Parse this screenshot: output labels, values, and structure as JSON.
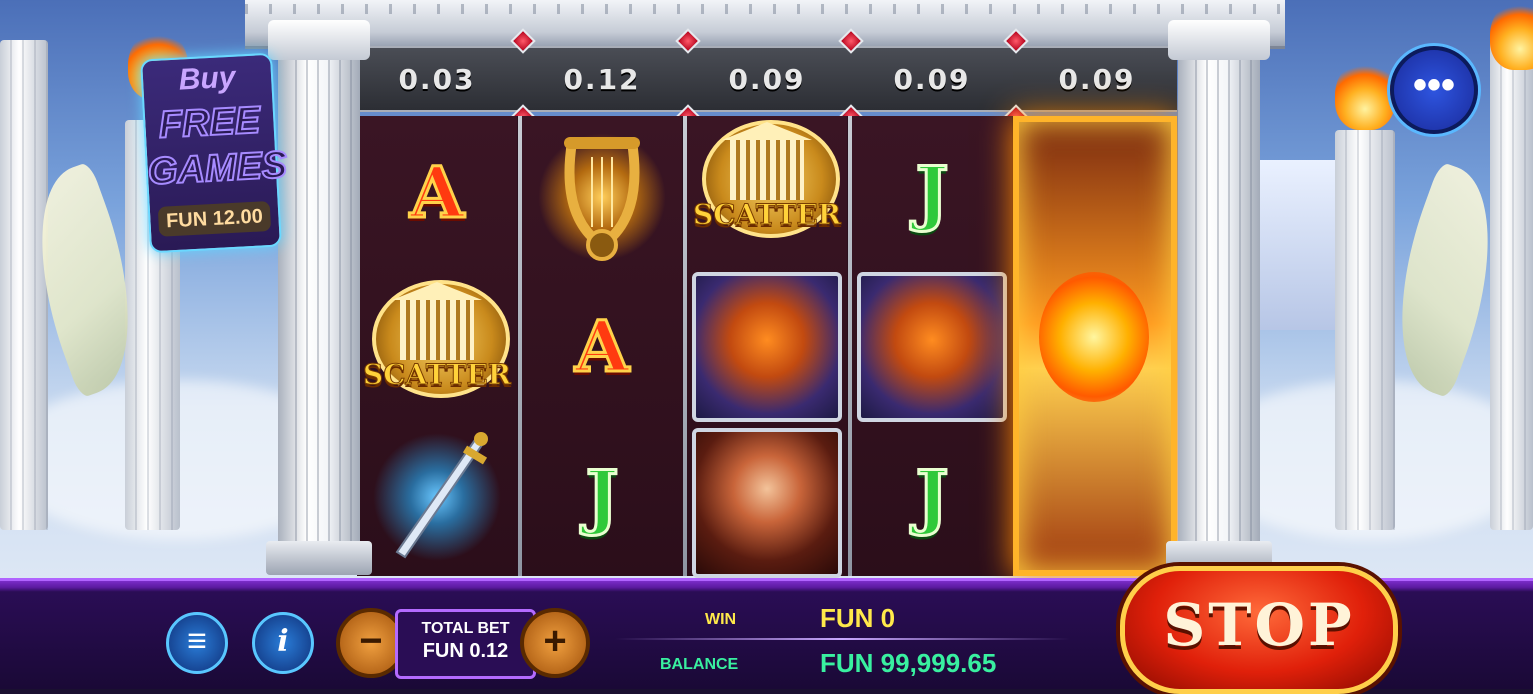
{
  "buy_feature": {
    "line1": "Buy",
    "line2": "FREE",
    "line3": "GAMES",
    "price": "FUN 12.00"
  },
  "multipliers": [
    "0.03",
    "0.12",
    "0.09",
    "0.09",
    "0.09"
  ],
  "reels": [
    [
      "A",
      "SCATTER",
      "sword"
    ],
    [
      "harp",
      "A",
      "J"
    ],
    [
      "SCATTER",
      "phoenix",
      "hero"
    ],
    [
      "J",
      "phoenix",
      "J"
    ],
    [
      "fire",
      "fire",
      "fire"
    ]
  ],
  "symbol_text": {
    "scatter": "SCATTER",
    "a": "A",
    "j": "J"
  },
  "menu_button": "•••",
  "controls": {
    "menu_icon": "≡",
    "info_icon": "i",
    "minus": "−",
    "plus": "+",
    "total_bet_label": "TOTAL BET",
    "total_bet_value": "FUN 0.12",
    "stop_label": "STOP"
  },
  "stats": {
    "win_label": "WIN",
    "win_value": "FUN 0",
    "balance_label": "BALANCE",
    "balance_value": "FUN 99,999.65"
  },
  "colors": {
    "accent_purple": "#b063ff",
    "win_yellow": "#ffe94a",
    "balance_green": "#39f0a0",
    "stop_red": "#e0200a"
  }
}
